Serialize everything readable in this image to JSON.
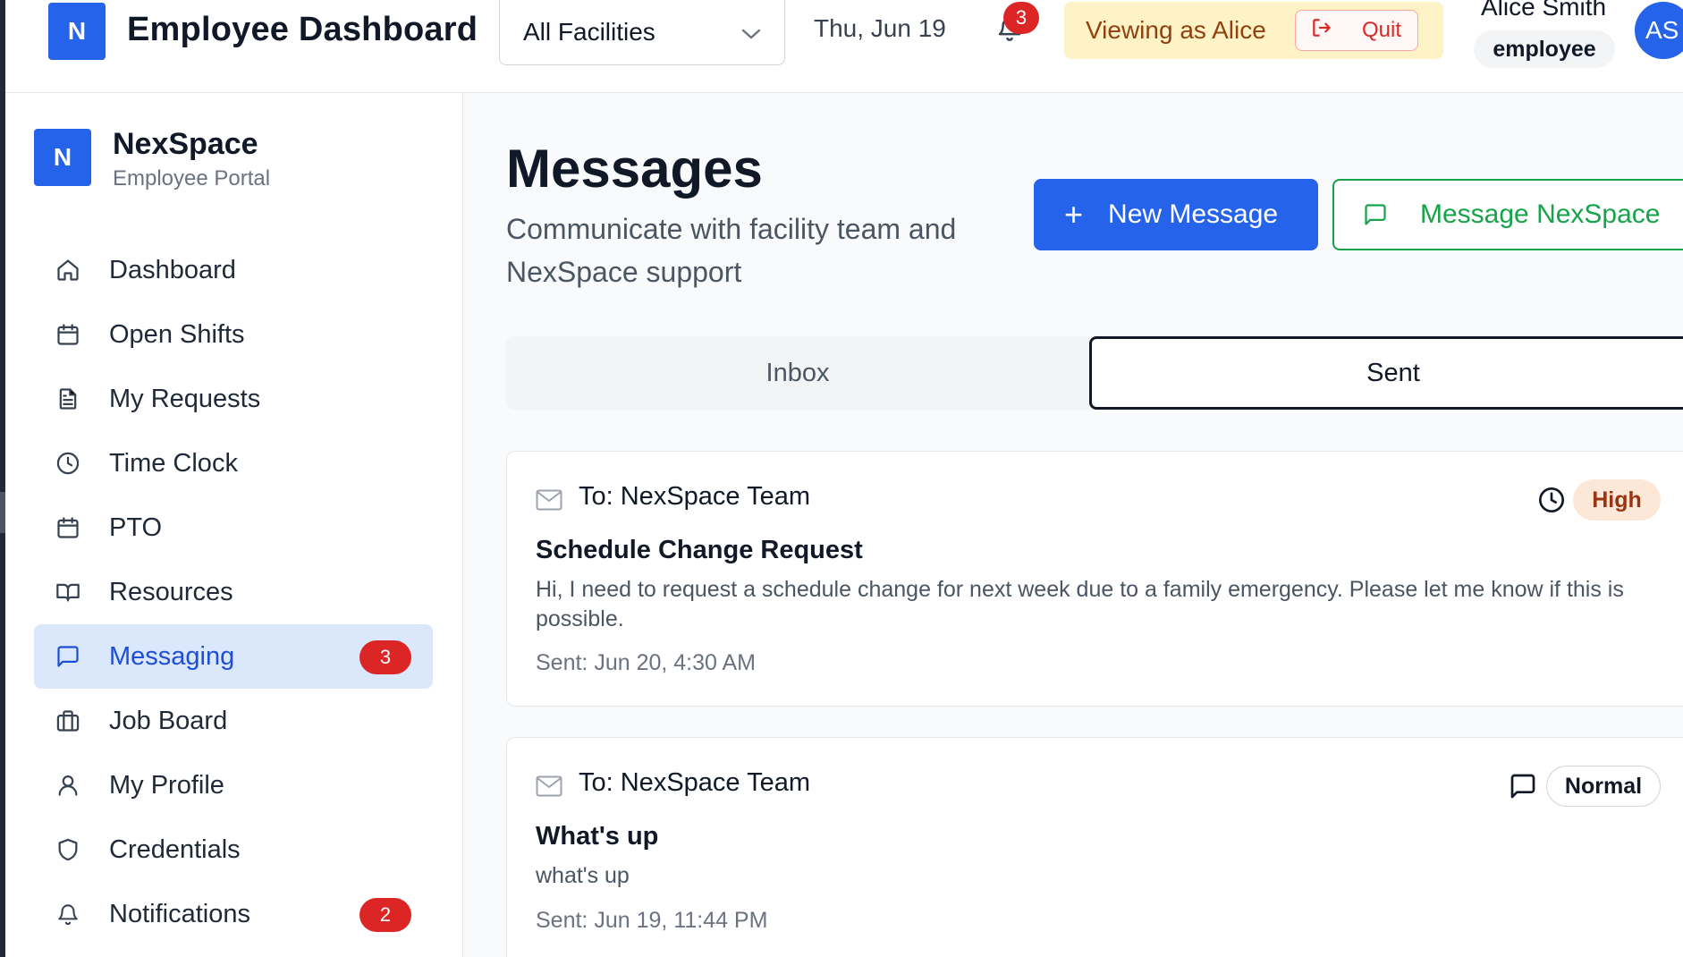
{
  "header": {
    "logo_letter": "N",
    "title": "Employee Dashboard",
    "facility_select_value": "All Facilities",
    "date": "Thu, Jun 19",
    "notification_count": "3",
    "viewing_as": "Viewing as Alice",
    "quit_label": "Quit",
    "user_name": "Alice Smith",
    "user_role": "employee",
    "avatar_initials": "AS"
  },
  "sidebar": {
    "brand_letter": "N",
    "brand_name": "NexSpace",
    "brand_subtitle": "Employee Portal",
    "items": [
      {
        "label": "Dashboard",
        "icon": "home-icon"
      },
      {
        "label": "Open Shifts",
        "icon": "calendar-icon"
      },
      {
        "label": "My Requests",
        "icon": "file-text-icon"
      },
      {
        "label": "Time Clock",
        "icon": "clock-icon"
      },
      {
        "label": "PTO",
        "icon": "calendar-icon"
      },
      {
        "label": "Resources",
        "icon": "book-open-icon"
      },
      {
        "label": "Messaging",
        "icon": "message-square-icon",
        "badge": "3",
        "active": true
      },
      {
        "label": "Job Board",
        "icon": "briefcase-icon"
      },
      {
        "label": "My Profile",
        "icon": "user-icon"
      },
      {
        "label": "Credentials",
        "icon": "shield-icon"
      },
      {
        "label": "Notifications",
        "icon": "bell-icon",
        "badge": "2"
      }
    ]
  },
  "main": {
    "title": "Messages",
    "subtitle": "Communicate with facility team and NexSpace support",
    "new_message_label": "New Message",
    "message_nexspace_label": "Message NexSpace",
    "tabs": [
      {
        "label": "Inbox",
        "selected": false
      },
      {
        "label": "Sent",
        "selected": true
      }
    ],
    "messages": [
      {
        "to": "To: NexSpace Team",
        "subject": "Schedule Change Request",
        "body": "Hi, I need to request a schedule change for next week due to a family emergency. Please let me know if this is possible.",
        "sent": "Sent: Jun 20, 4:30 AM",
        "status_icon": "clock-icon",
        "priority": "High"
      },
      {
        "to": "To: NexSpace Team",
        "subject": "What's up",
        "body": "what's up",
        "sent": "Sent: Jun 19, 11:44 PM",
        "status_icon": "message-square-icon",
        "priority": "Normal"
      }
    ]
  },
  "colors": {
    "primary": "#2563eb",
    "success": "#16a34a",
    "danger": "#dc2626",
    "active_nav_bg": "#dbe7fb",
    "viewing_banner_bg": "#fef3c7",
    "high_priority_bg": "#fde7d6"
  }
}
